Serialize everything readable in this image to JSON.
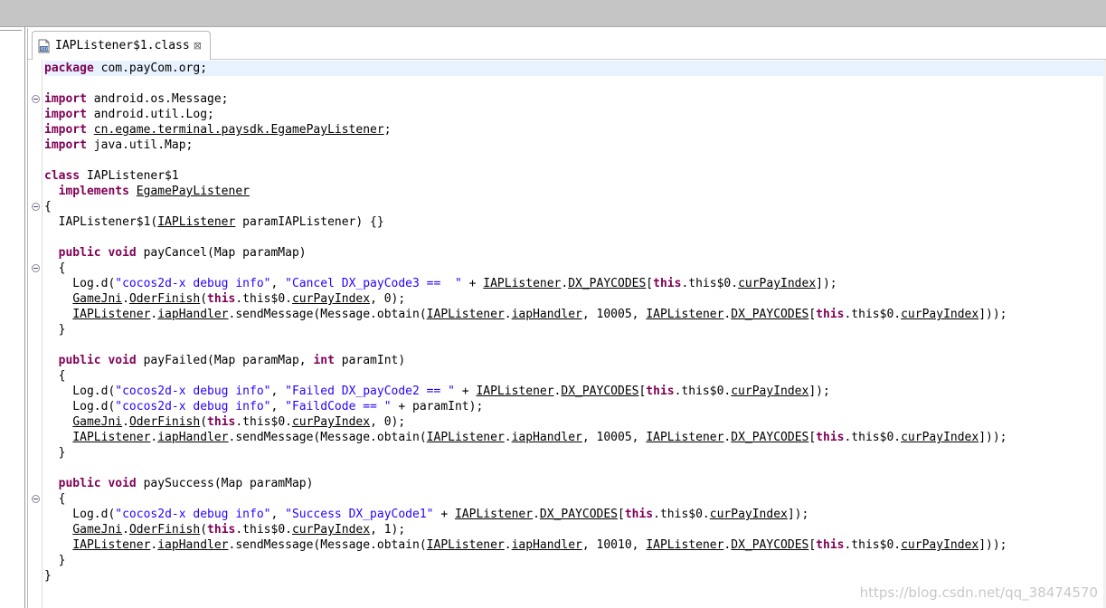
{
  "editor": {
    "tab": {
      "title": "IAPListener$1.class",
      "icon": "class-file-icon",
      "close_glyph": "⊠"
    },
    "lines": [
      {
        "current": true,
        "fold": false,
        "tokens": [
          [
            "kw",
            "package"
          ],
          [
            "t",
            " com.payCom.org;"
          ]
        ]
      },
      {
        "fold": false,
        "tokens": []
      },
      {
        "fold": true,
        "tokens": [
          [
            "kw",
            "import"
          ],
          [
            "t",
            " android.os.Message;"
          ]
        ]
      },
      {
        "fold": false,
        "tokens": [
          [
            "kw",
            "import"
          ],
          [
            "t",
            " android.util.Log;"
          ]
        ]
      },
      {
        "fold": false,
        "tokens": [
          [
            "kw",
            "import"
          ],
          [
            "t",
            " "
          ],
          [
            "u",
            "cn.egame.terminal.paysdk.EgamePayListener"
          ],
          [
            "t",
            ";"
          ]
        ]
      },
      {
        "fold": false,
        "tokens": [
          [
            "kw",
            "import"
          ],
          [
            "t",
            " java.util.Map;"
          ]
        ]
      },
      {
        "fold": false,
        "tokens": []
      },
      {
        "fold": false,
        "tokens": [
          [
            "kw",
            "class"
          ],
          [
            "t",
            " IAPListener$1"
          ]
        ]
      },
      {
        "fold": false,
        "tokens": [
          [
            "t",
            "  "
          ],
          [
            "kw",
            "implements"
          ],
          [
            "t",
            " "
          ],
          [
            "u",
            "EgamePayListener"
          ]
        ]
      },
      {
        "fold": true,
        "tokens": [
          [
            "t",
            "{"
          ]
        ]
      },
      {
        "fold": false,
        "tokens": [
          [
            "t",
            "  IAPListener$1("
          ],
          [
            "u",
            "IAPListener"
          ],
          [
            "t",
            " paramIAPListener) {}"
          ]
        ]
      },
      {
        "fold": false,
        "tokens": []
      },
      {
        "fold": false,
        "tokens": [
          [
            "t",
            "  "
          ],
          [
            "kw",
            "public"
          ],
          [
            "t",
            " "
          ],
          [
            "kw",
            "void"
          ],
          [
            "t",
            " payCancel(Map paramMap)"
          ]
        ]
      },
      {
        "fold": true,
        "tokens": [
          [
            "t",
            "  {"
          ]
        ]
      },
      {
        "fold": false,
        "tokens": [
          [
            "t",
            "    Log.d("
          ],
          [
            "str",
            "\"cocos2d-x debug info\""
          ],
          [
            "t",
            ", "
          ],
          [
            "str",
            "\"Cancel DX_payCode3 ==  \""
          ],
          [
            "t",
            " + "
          ],
          [
            "u",
            "IAPListener"
          ],
          [
            "t",
            "."
          ],
          [
            "u",
            "DX_PAYCODES"
          ],
          [
            "t",
            "["
          ],
          [
            "kw",
            "this"
          ],
          [
            "t",
            ".this$0."
          ],
          [
            "u",
            "curPayIndex"
          ],
          [
            "t",
            "]);"
          ]
        ]
      },
      {
        "fold": false,
        "tokens": [
          [
            "t",
            "    "
          ],
          [
            "u",
            "GameJni"
          ],
          [
            "t",
            "."
          ],
          [
            "u",
            "OderFinish"
          ],
          [
            "t",
            "("
          ],
          [
            "kw",
            "this"
          ],
          [
            "t",
            ".this$0."
          ],
          [
            "u",
            "curPayIndex"
          ],
          [
            "t",
            ", 0);"
          ]
        ]
      },
      {
        "fold": false,
        "tokens": [
          [
            "t",
            "    "
          ],
          [
            "u",
            "IAPListener"
          ],
          [
            "t",
            "."
          ],
          [
            "u",
            "iapHandler"
          ],
          [
            "t",
            ".sendMessage(Message.obtain("
          ],
          [
            "u",
            "IAPListener"
          ],
          [
            "t",
            "."
          ],
          [
            "u",
            "iapHandler"
          ],
          [
            "t",
            ", 10005, "
          ],
          [
            "u",
            "IAPListener"
          ],
          [
            "t",
            "."
          ],
          [
            "u",
            "DX_PAYCODES"
          ],
          [
            "t",
            "["
          ],
          [
            "kw",
            "this"
          ],
          [
            "t",
            ".this$0."
          ],
          [
            "u",
            "curPayIndex"
          ],
          [
            "t",
            "]));"
          ]
        ]
      },
      {
        "fold": false,
        "tokens": [
          [
            "t",
            "  }"
          ]
        ]
      },
      {
        "fold": false,
        "tokens": []
      },
      {
        "fold": false,
        "tokens": [
          [
            "t",
            "  "
          ],
          [
            "kw",
            "public"
          ],
          [
            "t",
            " "
          ],
          [
            "kw",
            "void"
          ],
          [
            "t",
            " payFailed(Map paramMap, "
          ],
          [
            "kw",
            "int"
          ],
          [
            "t",
            " paramInt)"
          ]
        ]
      },
      {
        "fold": false,
        "tokens": [
          [
            "t",
            "  {"
          ]
        ]
      },
      {
        "fold": false,
        "tokens": [
          [
            "t",
            "    Log.d("
          ],
          [
            "str",
            "\"cocos2d-x debug info\""
          ],
          [
            "t",
            ", "
          ],
          [
            "str",
            "\"Failed DX_payCode2 == \""
          ],
          [
            "t",
            " + "
          ],
          [
            "u",
            "IAPListener"
          ],
          [
            "t",
            "."
          ],
          [
            "u",
            "DX_PAYCODES"
          ],
          [
            "t",
            "["
          ],
          [
            "kw",
            "this"
          ],
          [
            "t",
            ".this$0."
          ],
          [
            "u",
            "curPayIndex"
          ],
          [
            "t",
            "]);"
          ]
        ]
      },
      {
        "fold": false,
        "tokens": [
          [
            "t",
            "    Log.d("
          ],
          [
            "str",
            "\"cocos2d-x debug info\""
          ],
          [
            "t",
            ", "
          ],
          [
            "str",
            "\"FaildCode == \""
          ],
          [
            "t",
            " + paramInt);"
          ]
        ]
      },
      {
        "fold": false,
        "tokens": [
          [
            "t",
            "    "
          ],
          [
            "u",
            "GameJni"
          ],
          [
            "t",
            "."
          ],
          [
            "u",
            "OderFinish"
          ],
          [
            "t",
            "("
          ],
          [
            "kw",
            "this"
          ],
          [
            "t",
            ".this$0."
          ],
          [
            "u",
            "curPayIndex"
          ],
          [
            "t",
            ", 0);"
          ]
        ]
      },
      {
        "fold": false,
        "tokens": [
          [
            "t",
            "    "
          ],
          [
            "u",
            "IAPListener"
          ],
          [
            "t",
            "."
          ],
          [
            "u",
            "iapHandler"
          ],
          [
            "t",
            ".sendMessage(Message.obtain("
          ],
          [
            "u",
            "IAPListener"
          ],
          [
            "t",
            "."
          ],
          [
            "u",
            "iapHandler"
          ],
          [
            "t",
            ", 10005, "
          ],
          [
            "u",
            "IAPListener"
          ],
          [
            "t",
            "."
          ],
          [
            "u",
            "DX_PAYCODES"
          ],
          [
            "t",
            "["
          ],
          [
            "kw",
            "this"
          ],
          [
            "t",
            ".this$0."
          ],
          [
            "u",
            "curPayIndex"
          ],
          [
            "t",
            "]));"
          ]
        ]
      },
      {
        "fold": false,
        "tokens": [
          [
            "t",
            "  }"
          ]
        ]
      },
      {
        "fold": false,
        "tokens": []
      },
      {
        "fold": false,
        "tokens": [
          [
            "t",
            "  "
          ],
          [
            "kw",
            "public"
          ],
          [
            "t",
            " "
          ],
          [
            "kw",
            "void"
          ],
          [
            "t",
            " paySuccess(Map paramMap)"
          ]
        ]
      },
      {
        "fold": true,
        "tokens": [
          [
            "t",
            "  {"
          ]
        ]
      },
      {
        "fold": false,
        "tokens": [
          [
            "t",
            "    Log.d("
          ],
          [
            "str",
            "\"cocos2d-x debug info\""
          ],
          [
            "t",
            ", "
          ],
          [
            "str",
            "\"Success DX_payCode1\""
          ],
          [
            "t",
            " + "
          ],
          [
            "u",
            "IAPListener"
          ],
          [
            "t",
            "."
          ],
          [
            "u",
            "DX_PAYCODES"
          ],
          [
            "t",
            "["
          ],
          [
            "kw",
            "this"
          ],
          [
            "t",
            ".this$0."
          ],
          [
            "u",
            "curPayIndex"
          ],
          [
            "t",
            "]);"
          ]
        ]
      },
      {
        "fold": false,
        "tokens": [
          [
            "t",
            "    "
          ],
          [
            "u",
            "GameJni"
          ],
          [
            "t",
            "."
          ],
          [
            "u",
            "OderFinish"
          ],
          [
            "t",
            "("
          ],
          [
            "kw",
            "this"
          ],
          [
            "t",
            ".this$0."
          ],
          [
            "u",
            "curPayIndex"
          ],
          [
            "t",
            ", 1);"
          ]
        ]
      },
      {
        "fold": false,
        "tokens": [
          [
            "t",
            "    "
          ],
          [
            "u",
            "IAPListener"
          ],
          [
            "t",
            "."
          ],
          [
            "u",
            "iapHandler"
          ],
          [
            "t",
            ".sendMessage(Message.obtain("
          ],
          [
            "u",
            "IAPListener"
          ],
          [
            "t",
            "."
          ],
          [
            "u",
            "iapHandler"
          ],
          [
            "t",
            ", 10010, "
          ],
          [
            "u",
            "IAPListener"
          ],
          [
            "t",
            "."
          ],
          [
            "u",
            "DX_PAYCODES"
          ],
          [
            "t",
            "["
          ],
          [
            "kw",
            "this"
          ],
          [
            "t",
            ".this$0."
          ],
          [
            "u",
            "curPayIndex"
          ],
          [
            "t",
            "]));"
          ]
        ]
      },
      {
        "fold": false,
        "tokens": [
          [
            "t",
            "  }"
          ]
        ]
      },
      {
        "fold": false,
        "tokens": [
          [
            "t",
            "}"
          ]
        ]
      }
    ]
  },
  "watermark": "https://blog.csdn.net/qq_38474570",
  "colors": {
    "keyword": "#7f0055",
    "string": "#2a00ff",
    "current_line": "#e8f2fe",
    "title_bar": "#c5c5c5"
  }
}
